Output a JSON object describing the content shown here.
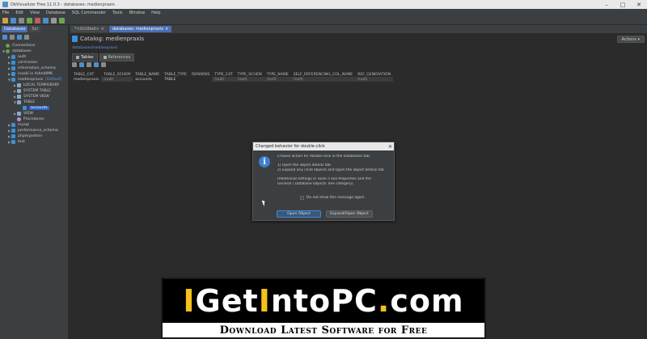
{
  "window": {
    "title": "DbVisualizer Free 11.0.3 - databases: medienpraxis",
    "controls": [
      "–",
      "□",
      "✕"
    ]
  },
  "menubar": {
    "items": [
      "File",
      "Edit",
      "View",
      "Database",
      "SQL Commander",
      "Tools",
      "Window",
      "Help"
    ]
  },
  "left_panel": {
    "tabs": [
      "Databases",
      "Scr"
    ],
    "tree": [
      {
        "label": "Connections",
        "depth": 0,
        "icon": "connections-icon"
      },
      {
        "label": "databases",
        "depth": 0,
        "icon": "connection-icon",
        "expanded": true
      },
      {
        "label": "auth",
        "depth": 1,
        "icon": "database-icon"
      },
      {
        "label": "cal-tracker",
        "depth": 1,
        "icon": "database-icon"
      },
      {
        "label": "information_schema",
        "depth": 1,
        "icon": "database-icon"
      },
      {
        "label": "invoki in Arbeit/MK",
        "depth": 1,
        "icon": "database-icon"
      },
      {
        "label": "medienpraxis",
        "depth": 1,
        "icon": "database-icon",
        "expanded": true,
        "badge": "[Default]"
      },
      {
        "label": "LOCAL TEMPORARY",
        "depth": 2,
        "icon": "folder-icon"
      },
      {
        "label": "SYSTEM TABLE",
        "depth": 2,
        "icon": "folder-icon"
      },
      {
        "label": "SYSTEM VIEW",
        "depth": 2,
        "icon": "folder-icon"
      },
      {
        "label": "TABLE",
        "depth": 2,
        "icon": "folder-icon",
        "expanded": true
      },
      {
        "label": "accounts",
        "depth": 3,
        "icon": "table-icon",
        "selected": true
      },
      {
        "label": "VIEW",
        "depth": 2,
        "icon": "folder-icon"
      },
      {
        "label": "Procedures",
        "depth": 2,
        "icon": "procedures-icon"
      },
      {
        "label": "mysql",
        "depth": 1,
        "icon": "database-icon"
      },
      {
        "label": "performance_schema",
        "depth": 1,
        "icon": "database-icon"
      },
      {
        "label": "phpmyadmin",
        "depth": 1,
        "icon": "database-icon"
      },
      {
        "label": "test",
        "depth": 1,
        "icon": "database-icon"
      }
    ]
  },
  "editor_tabs": [
    {
      "label": "*<Untitled>",
      "active": false
    },
    {
      "label": "databases: medienpraxis",
      "active": true
    }
  ],
  "main": {
    "catalog_title": "Catalog: medienpraxis",
    "actions_label": "Actions ▾",
    "path": "databases/medienpraxis",
    "subtabs": [
      {
        "label": "Tables",
        "active": true
      },
      {
        "label": "References",
        "active": false
      }
    ],
    "table": {
      "headers": [
        "TABLE_CAT",
        "TABLE_SCHEM",
        "TABLE_NAME",
        "TABLE_TYPE",
        "REMARKS",
        "TYPE_CAT",
        "TYPE_SCHEM",
        "TYPE_NAME",
        "SELF_REFERENCING_COL_NAME",
        "REF_GENERATION"
      ],
      "rows": [
        [
          "medienpraxis",
          "(null)",
          "accounts",
          "TABLE",
          "",
          "(null)",
          "(null)",
          "(null)",
          "(null)",
          "(null)"
        ]
      ]
    }
  },
  "dialog": {
    "title": "Changed behavior for double-click",
    "close": "✕",
    "lines": [
      "Choose action for double-click in the Databases tab:",
      "",
      "1) Open the object details tab",
      "2) Expand any child objects and Open the object details tab",
      "",
      "(Additional settings in Tools->Tool Properties and the",
      "General / Database Objects Tree category)."
    ],
    "checkbox_label": "Do not show this message again",
    "primary_button": "Open Object",
    "secondary_button": "Expand/Open Object"
  },
  "banner": {
    "logo_parts": [
      {
        "text": "I",
        "color": "yellow"
      },
      {
        "text": "Get",
        "color": "white"
      },
      {
        "text": "I",
        "color": "yellow"
      },
      {
        "text": "nto",
        "color": "white"
      },
      {
        "text": "PC",
        "color": "white"
      },
      {
        "text": ".",
        "color": "yellow"
      },
      {
        "text": "com",
        "color": "white"
      }
    ],
    "tagline": "Download Latest Software for Free"
  },
  "colors": {
    "accent": "#4b6eaf",
    "banner_yellow": "#f2c21b",
    "dialog_info": "#3d7fd1"
  }
}
